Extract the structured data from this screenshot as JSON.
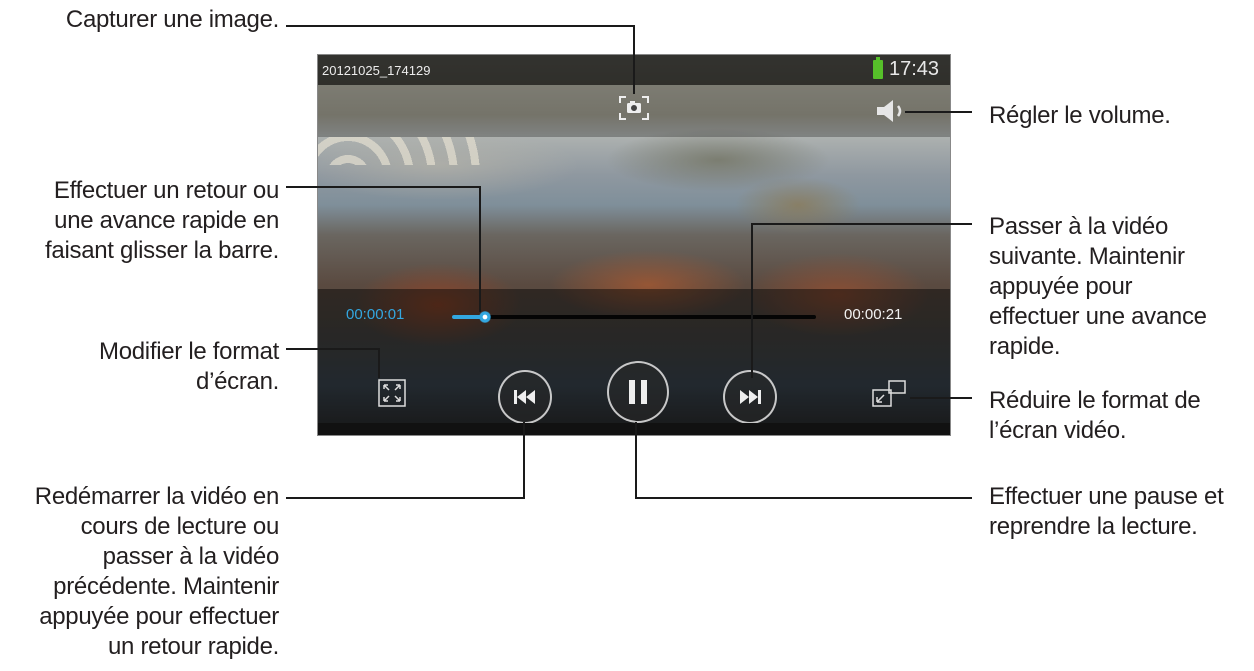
{
  "player": {
    "file_name": "20121025_174129",
    "clock": "17:43",
    "current_time": "00:00:01",
    "total_time": "00:00:21",
    "progress_fraction": 0.09,
    "accent_color": "#33a7e0",
    "battery_color": "#56c02a",
    "icons": {
      "capture": "camera-capture-icon",
      "volume": "speaker-volume-icon",
      "aspect": "aspect-ratio-icon",
      "previous": "skip-previous-icon",
      "pause": "pause-icon",
      "next": "skip-next-icon",
      "popup": "popup-player-icon"
    }
  },
  "annotations": {
    "capture": "Capturer une image.",
    "volume": "Régler le volume.",
    "seek": [
      "Effectuer un retour ou",
      "une avance rapide en",
      "faisant glisser la barre."
    ],
    "next": [
      "Passer à la vidéo",
      "suivante. Maintenir",
      "appuyée pour",
      "effectuer une avance",
      "rapide."
    ],
    "aspect": [
      "Modifier le format",
      "d’écran."
    ],
    "popup": [
      "Réduire le format de",
      "l’écran vidéo."
    ],
    "previous": [
      "Redémarrer la vidéo en",
      "cours de lecture ou",
      "passer à la vidéo",
      "précédente. Maintenir",
      "appuyée pour effectuer",
      "un retour rapide."
    ],
    "pause": [
      "Effectuer une pause et",
      "reprendre la lecture."
    ]
  }
}
